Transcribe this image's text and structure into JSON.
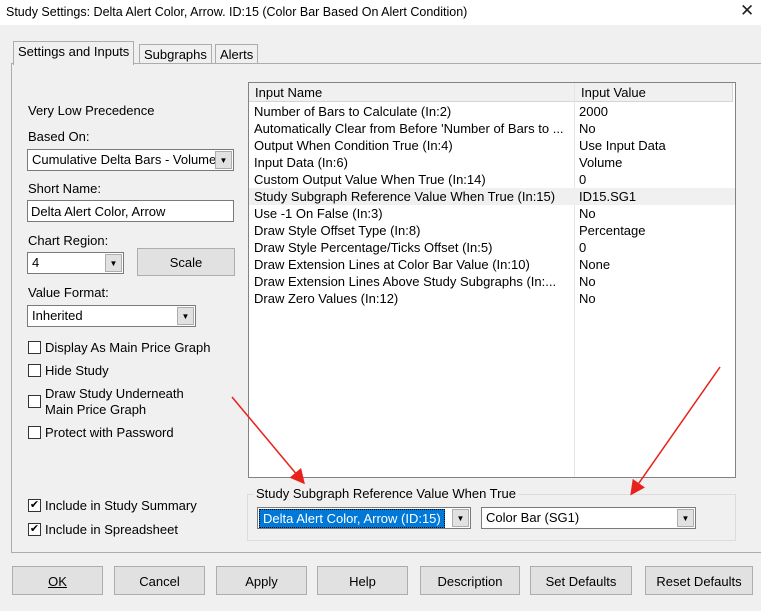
{
  "window": {
    "title": "Study Settings: Delta Alert Color, Arrow. ID:15 (Color Bar Based On Alert Condition)",
    "close": "✕"
  },
  "tabs": [
    {
      "label": "Settings and Inputs"
    },
    {
      "label": "Subgraphs"
    },
    {
      "label": "Alerts"
    }
  ],
  "left": {
    "precedence": "Very Low Precedence",
    "based_on_label": "Based On:",
    "based_on_value": "Cumulative Delta Bars - Volume",
    "short_name_label": "Short Name:",
    "short_name_value": "Delta Alert Color, Arrow",
    "chart_region_label": "Chart Region:",
    "chart_region_value": "4",
    "scale_label": "Scale",
    "value_format_label": "Value Format:",
    "value_format_value": "Inherited",
    "checkboxes": [
      {
        "label": "Display As Main Price Graph",
        "checked": false
      },
      {
        "label": "Hide Study",
        "checked": false
      },
      {
        "label": "Draw Study Underneath",
        "label2": "Main Price Graph",
        "checked": false
      },
      {
        "label": "Protect with Password",
        "checked": false
      },
      {
        "label": "Include in Study Summary",
        "checked": true
      },
      {
        "label": "Include in Spreadsheet",
        "checked": true
      }
    ]
  },
  "grid": {
    "headers": [
      "Input Name",
      "Input Value"
    ],
    "rows": [
      {
        "name": "Number of Bars to Calculate   (In:2)",
        "value": "2000"
      },
      {
        "name": "Automatically Clear from Before 'Number of Bars to ...",
        "value": "No"
      },
      {
        "name": "Output When Condition True   (In:4)",
        "value": "Use Input Data"
      },
      {
        "name": "Input Data   (In:6)",
        "value": "Volume"
      },
      {
        "name": "Custom Output Value When True   (In:14)",
        "value": "0"
      },
      {
        "name": "Study Subgraph Reference Value When True   (In:15)",
        "value": "ID15.SG1"
      },
      {
        "name": "Use -1 On False   (In:3)",
        "value": "No"
      },
      {
        "name": "Draw Style Offset Type   (In:8)",
        "value": "Percentage"
      },
      {
        "name": "Draw Style Percentage/Ticks Offset   (In:5)",
        "value": "0"
      },
      {
        "name": "Draw Extension Lines at Color Bar Value   (In:10)",
        "value": "None"
      },
      {
        "name": "Draw Extension Lines Above Study Subgraphs   (In:...",
        "value": "No"
      },
      {
        "name": "Draw Zero Values   (In:12)",
        "value": "No"
      }
    ]
  },
  "group": {
    "label": "Study Subgraph Reference Value When True",
    "study": "Delta Alert Color, Arrow (ID:15)",
    "subgraph": "Color Bar (SG1)"
  },
  "buttons": {
    "ok": "OK",
    "cancel": "Cancel",
    "apply": "Apply",
    "help": "Help",
    "description": "Description",
    "set_defaults": "Set Defaults",
    "reset_defaults": "Reset Defaults"
  },
  "colors": {
    "selection": "#0078d7",
    "arrow": "#e8211b"
  }
}
